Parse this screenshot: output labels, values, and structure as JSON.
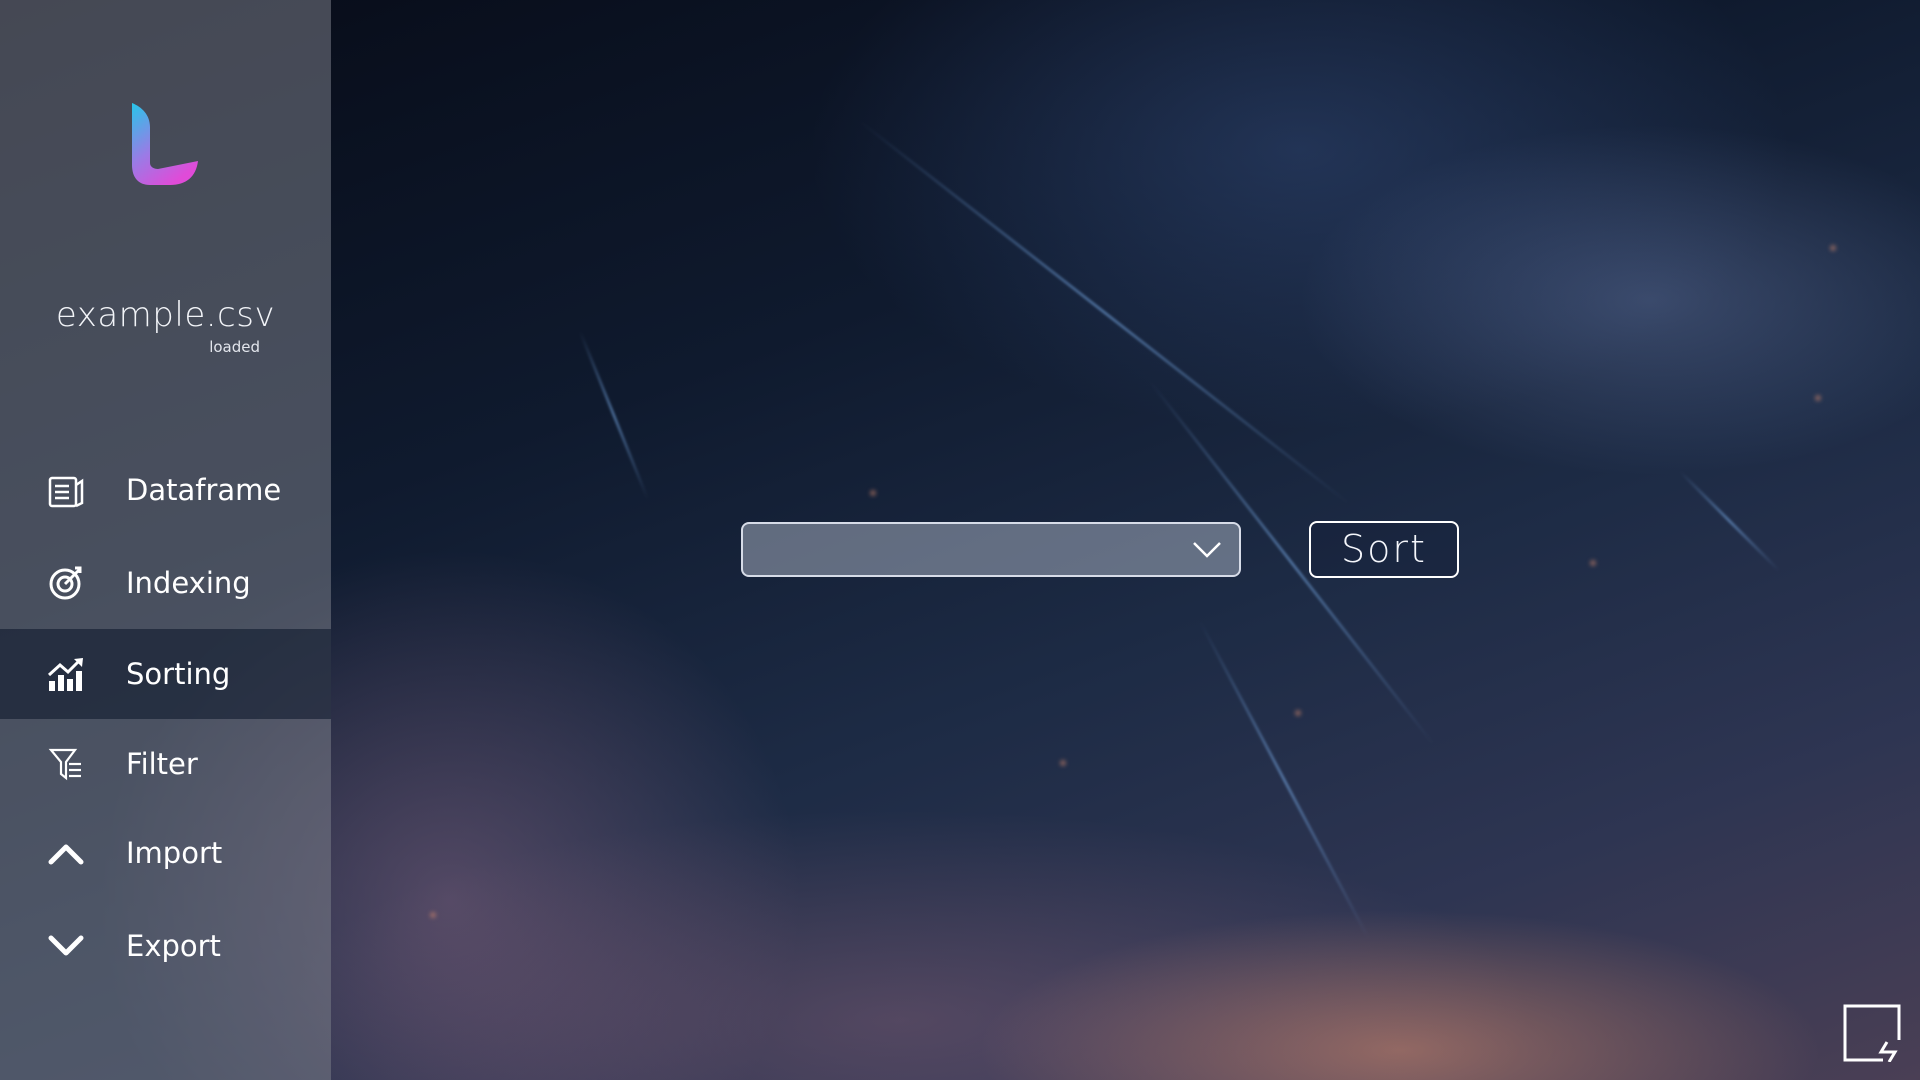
{
  "file": {
    "name": "example.csv",
    "status": "loaded"
  },
  "nav": {
    "items": [
      {
        "label": "Dataframe",
        "icon": "dataframe-icon"
      },
      {
        "label": "Indexing",
        "icon": "target-icon"
      },
      {
        "label": "Sorting",
        "icon": "chart-up-icon",
        "active": true
      },
      {
        "label": "Filter",
        "icon": "filter-icon"
      },
      {
        "label": "Import",
        "icon": "chevron-up-icon"
      },
      {
        "label": "Export",
        "icon": "chevron-down-icon"
      }
    ]
  },
  "sort_panel": {
    "dropdown_value": "",
    "button_label": "Sort"
  },
  "colors": {
    "sidebar": "#7c7f89",
    "active_item": "#0a1428",
    "logo_gradient_start": "#27c6e8",
    "logo_gradient_end": "#e04bd8"
  },
  "corner": {
    "icon": "swap-window-icon"
  }
}
